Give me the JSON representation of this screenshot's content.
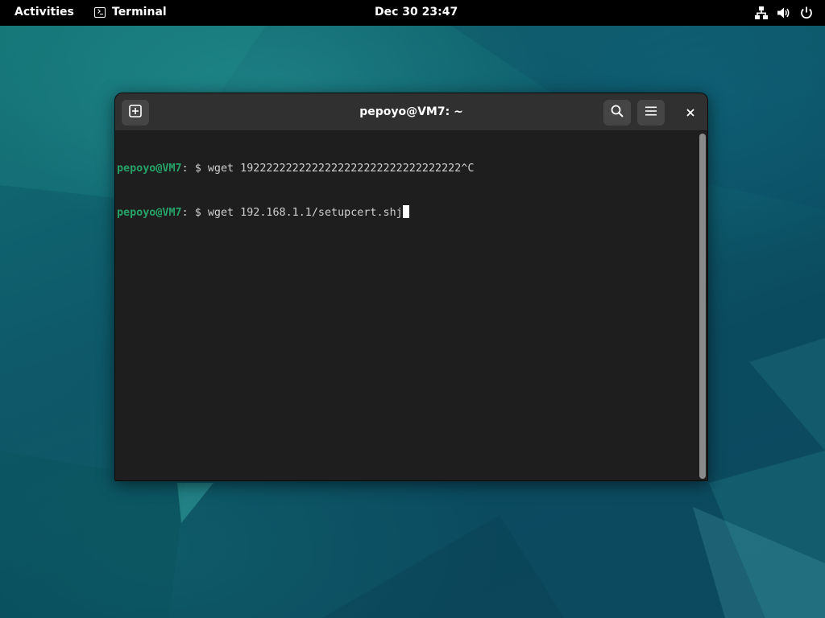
{
  "topbar": {
    "activities": "Activities",
    "app_name": "Terminal",
    "app_icon": "terminal-icon",
    "clock": "Dec 30  23:47",
    "tray_icons": [
      "network-icon",
      "volume-icon",
      "power-icon"
    ]
  },
  "window": {
    "title": "pepoyo@VM7: ~",
    "buttons": [
      "new-tab-icon",
      "search-icon",
      "hamburger-menu-icon",
      "close-icon"
    ]
  },
  "terminal": {
    "lines": [
      {
        "user": "pepoyo@VM7",
        "sep": ":",
        "cwd": " ",
        "symbol": "$",
        "command": "wget 1922222222222222222222222222222222^C"
      },
      {
        "user": "pepoyo@VM7",
        "sep": ":",
        "cwd": " ",
        "symbol": "$",
        "command": "wget 192.168.1.1/setupcert.shj"
      }
    ]
  },
  "colors": {
    "prompt_user": "#26a269",
    "terminal_bg": "#1e1e1e",
    "headerbar_bg": "#303030"
  }
}
